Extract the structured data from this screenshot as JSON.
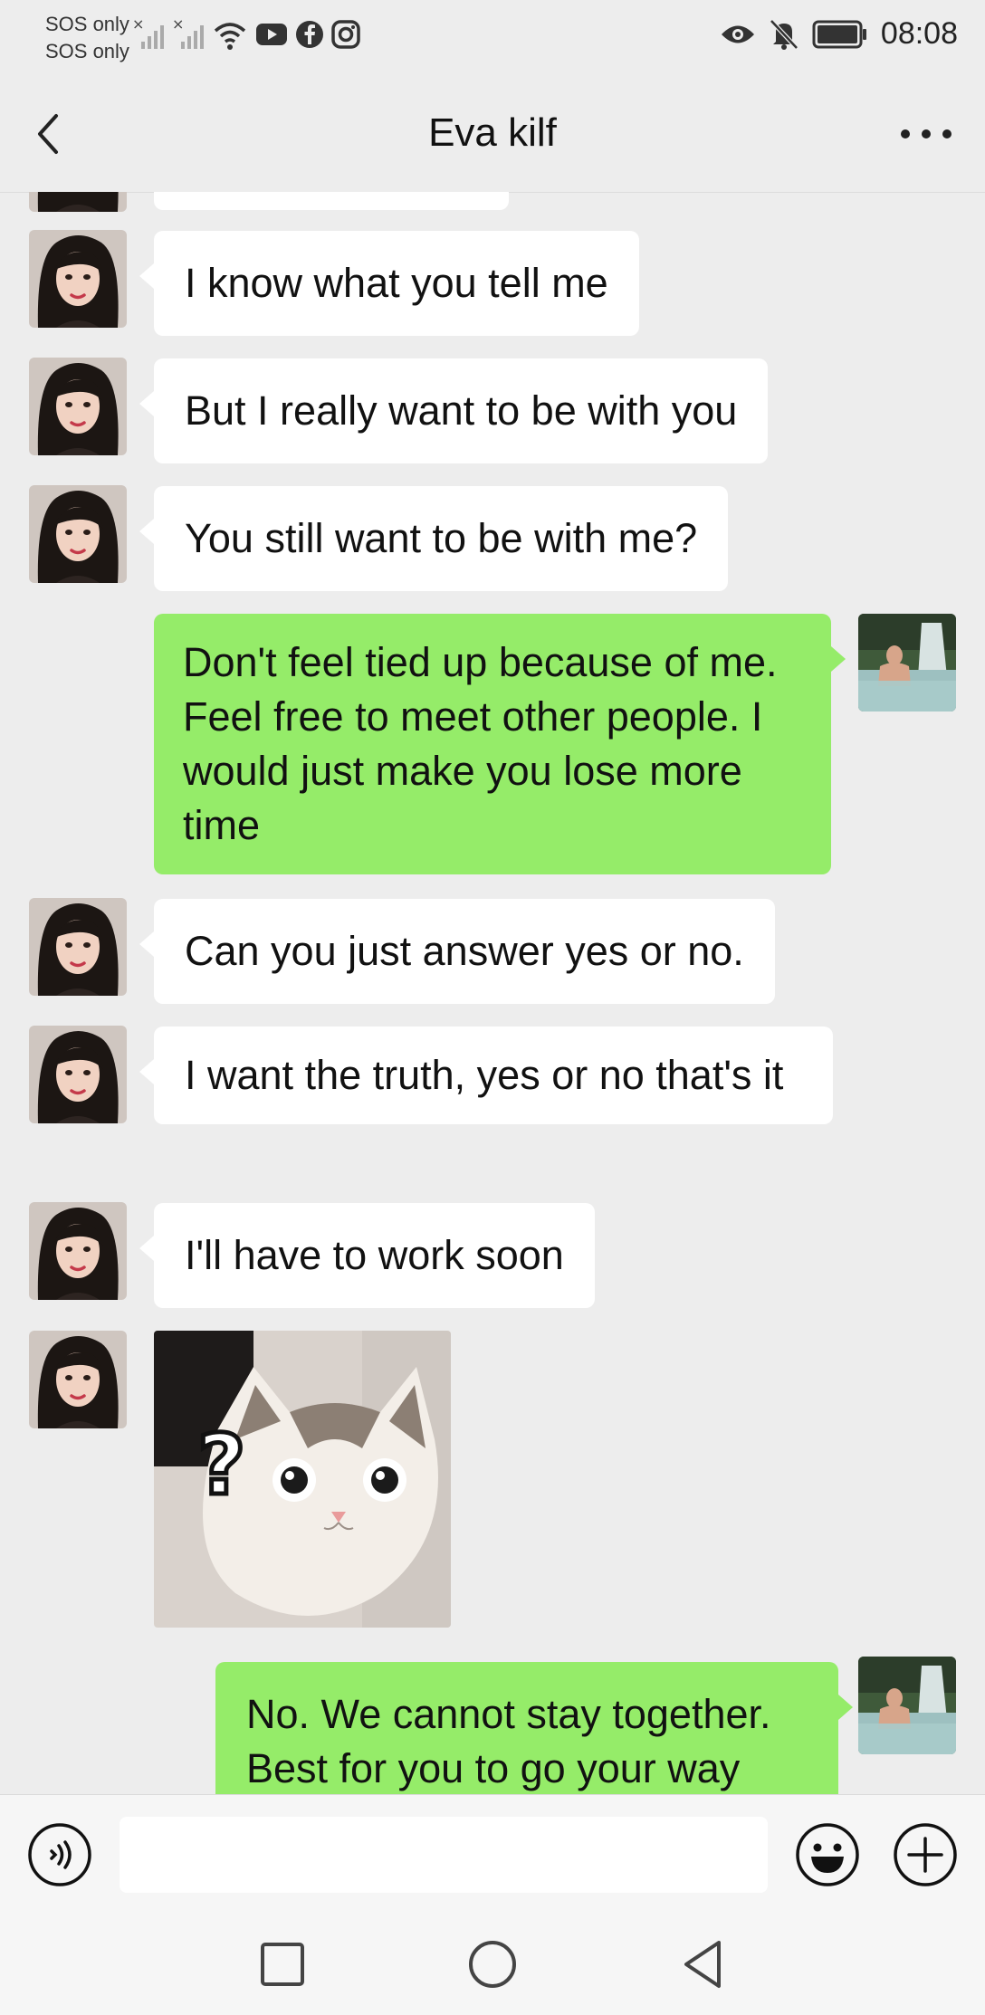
{
  "status_bar": {
    "sos_line1": "SOS only",
    "sos_line2": "SOS only",
    "time": "08:08",
    "icons": [
      "signal-off-icon",
      "signal-off-icon",
      "wifi-icon",
      "youtube-icon",
      "facebook-icon",
      "instagram-icon",
      "eye-icon",
      "bell-muted-icon",
      "battery-icon"
    ]
  },
  "header": {
    "title": "Eva kilf",
    "back_icon": "chevron-left-icon",
    "more_icon": "more-horizontal-icon"
  },
  "messages": [
    {
      "from": "contact",
      "type": "text",
      "text": "I know what you tell me"
    },
    {
      "from": "contact",
      "type": "text",
      "text": "But I really want to be with you"
    },
    {
      "from": "contact",
      "type": "text",
      "text": "You still want to be with me?"
    },
    {
      "from": "me",
      "type": "text",
      "text": "Don't feel tied up because of me. Feel free to meet other people. I would just make you lose more time"
    },
    {
      "from": "contact",
      "type": "text",
      "text": "Can you just answer yes or no."
    },
    {
      "from": "contact",
      "type": "text",
      "text": "I want the truth, yes or no that's it"
    },
    {
      "from": "contact",
      "type": "text",
      "text": "I'll have to work soon"
    },
    {
      "from": "contact",
      "type": "sticker",
      "text": "?"
    },
    {
      "from": "me",
      "type": "text",
      "text": "No. We cannot stay together. Best for you to go your way"
    }
  ],
  "input_bar": {
    "voice_icon": "voice-icon",
    "placeholder": "",
    "emoji_icon": "emoji-icon",
    "add_icon": "plus-circle-icon"
  },
  "nav_bar": {
    "icons": [
      "recents-square-icon",
      "home-circle-icon",
      "back-triangle-icon"
    ]
  },
  "colors": {
    "background": "#ededed",
    "outgoing_bubble": "#95ec69",
    "incoming_bubble": "#ffffff"
  }
}
